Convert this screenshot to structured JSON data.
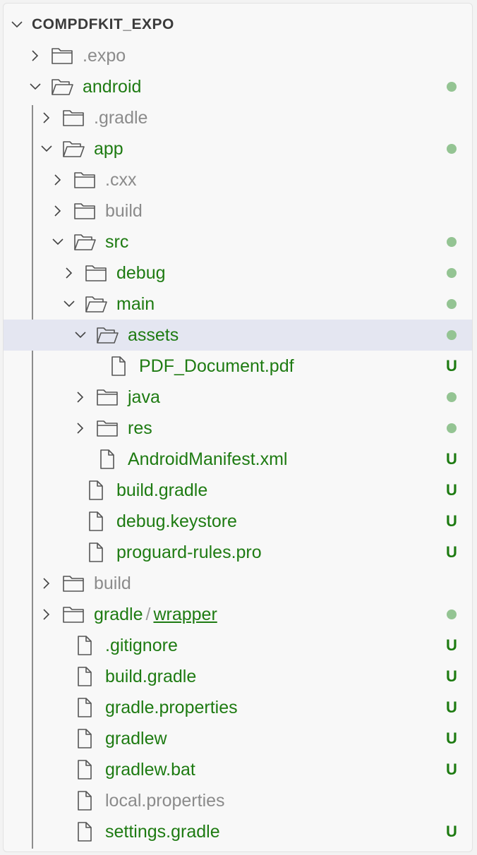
{
  "explorer": {
    "root": "COMPDFKIT_EXPO",
    "items": [
      {
        "label": ".expo",
        "depth": 1,
        "kind": "folder",
        "expanded": false,
        "tone": "gray",
        "status": ""
      },
      {
        "label": "android",
        "depth": 1,
        "kind": "folder",
        "expanded": true,
        "tone": "green",
        "status": "dot"
      },
      {
        "label": ".gradle",
        "depth": 2,
        "kind": "folder",
        "expanded": false,
        "tone": "gray",
        "status": ""
      },
      {
        "label": "app",
        "depth": 2,
        "kind": "folder",
        "expanded": true,
        "tone": "green",
        "status": "dot"
      },
      {
        "label": ".cxx",
        "depth": 3,
        "kind": "folder",
        "expanded": false,
        "tone": "gray",
        "status": ""
      },
      {
        "label": "build",
        "depth": 3,
        "kind": "folder",
        "expanded": false,
        "tone": "gray",
        "status": ""
      },
      {
        "label": "src",
        "depth": 3,
        "kind": "folder",
        "expanded": true,
        "tone": "green",
        "status": "dot"
      },
      {
        "label": "debug",
        "depth": 4,
        "kind": "folder",
        "expanded": false,
        "tone": "green",
        "status": "dot"
      },
      {
        "label": "main",
        "depth": 4,
        "kind": "folder",
        "expanded": true,
        "tone": "green",
        "status": "dot"
      },
      {
        "label": "assets",
        "depth": 5,
        "kind": "folder",
        "expanded": true,
        "tone": "green",
        "status": "dot",
        "selected": true
      },
      {
        "label": "PDF_Document.pdf",
        "depth": 6,
        "kind": "file",
        "tone": "green",
        "status": "U"
      },
      {
        "label": "java",
        "depth": 5,
        "kind": "folder",
        "expanded": false,
        "tone": "green",
        "status": "dot"
      },
      {
        "label": "res",
        "depth": 5,
        "kind": "folder",
        "expanded": false,
        "tone": "green",
        "status": "dot"
      },
      {
        "label": "AndroidManifest.xml",
        "depth": 5,
        "kind": "file",
        "tone": "green",
        "status": "U"
      },
      {
        "label": "build.gradle",
        "depth": 4,
        "kind": "file",
        "tone": "green",
        "status": "U"
      },
      {
        "label": "debug.keystore",
        "depth": 4,
        "kind": "file",
        "tone": "green",
        "status": "U"
      },
      {
        "label": "proguard-rules.pro",
        "depth": 4,
        "kind": "file",
        "tone": "green",
        "status": "U"
      },
      {
        "label": "build",
        "depth": 2,
        "kind": "folder",
        "expanded": false,
        "tone": "gray",
        "status": ""
      },
      {
        "label": "gradle",
        "sublabel": "wrapper",
        "depth": 2,
        "kind": "folder",
        "expanded": false,
        "tone": "green",
        "status": "dot"
      },
      {
        "label": ".gitignore",
        "depth": 3,
        "kind": "file",
        "tone": "green",
        "status": "U"
      },
      {
        "label": "build.gradle",
        "depth": 3,
        "kind": "file",
        "tone": "green",
        "status": "U"
      },
      {
        "label": "gradle.properties",
        "depth": 3,
        "kind": "file",
        "tone": "green",
        "status": "U"
      },
      {
        "label": "gradlew",
        "depth": 3,
        "kind": "file",
        "tone": "green",
        "status": "U"
      },
      {
        "label": "gradlew.bat",
        "depth": 3,
        "kind": "file",
        "tone": "green",
        "status": "U"
      },
      {
        "label": "local.properties",
        "depth": 3,
        "kind": "file",
        "tone": "gray",
        "status": ""
      },
      {
        "label": "settings.gradle",
        "depth": 3,
        "kind": "file",
        "tone": "green",
        "status": "U"
      }
    ]
  },
  "colors": {
    "untracked_text": "#1e7b12",
    "ignored_text": "#8b8b8b",
    "modified_dot": "#94c493",
    "selected_row": "#e4e6f1"
  },
  "icons": {
    "collapsed": "chevron-right-icon",
    "expanded": "chevron-down-icon",
    "folder": "folder-icon",
    "open_folder": "folder-open-icon",
    "file": "file-icon"
  }
}
